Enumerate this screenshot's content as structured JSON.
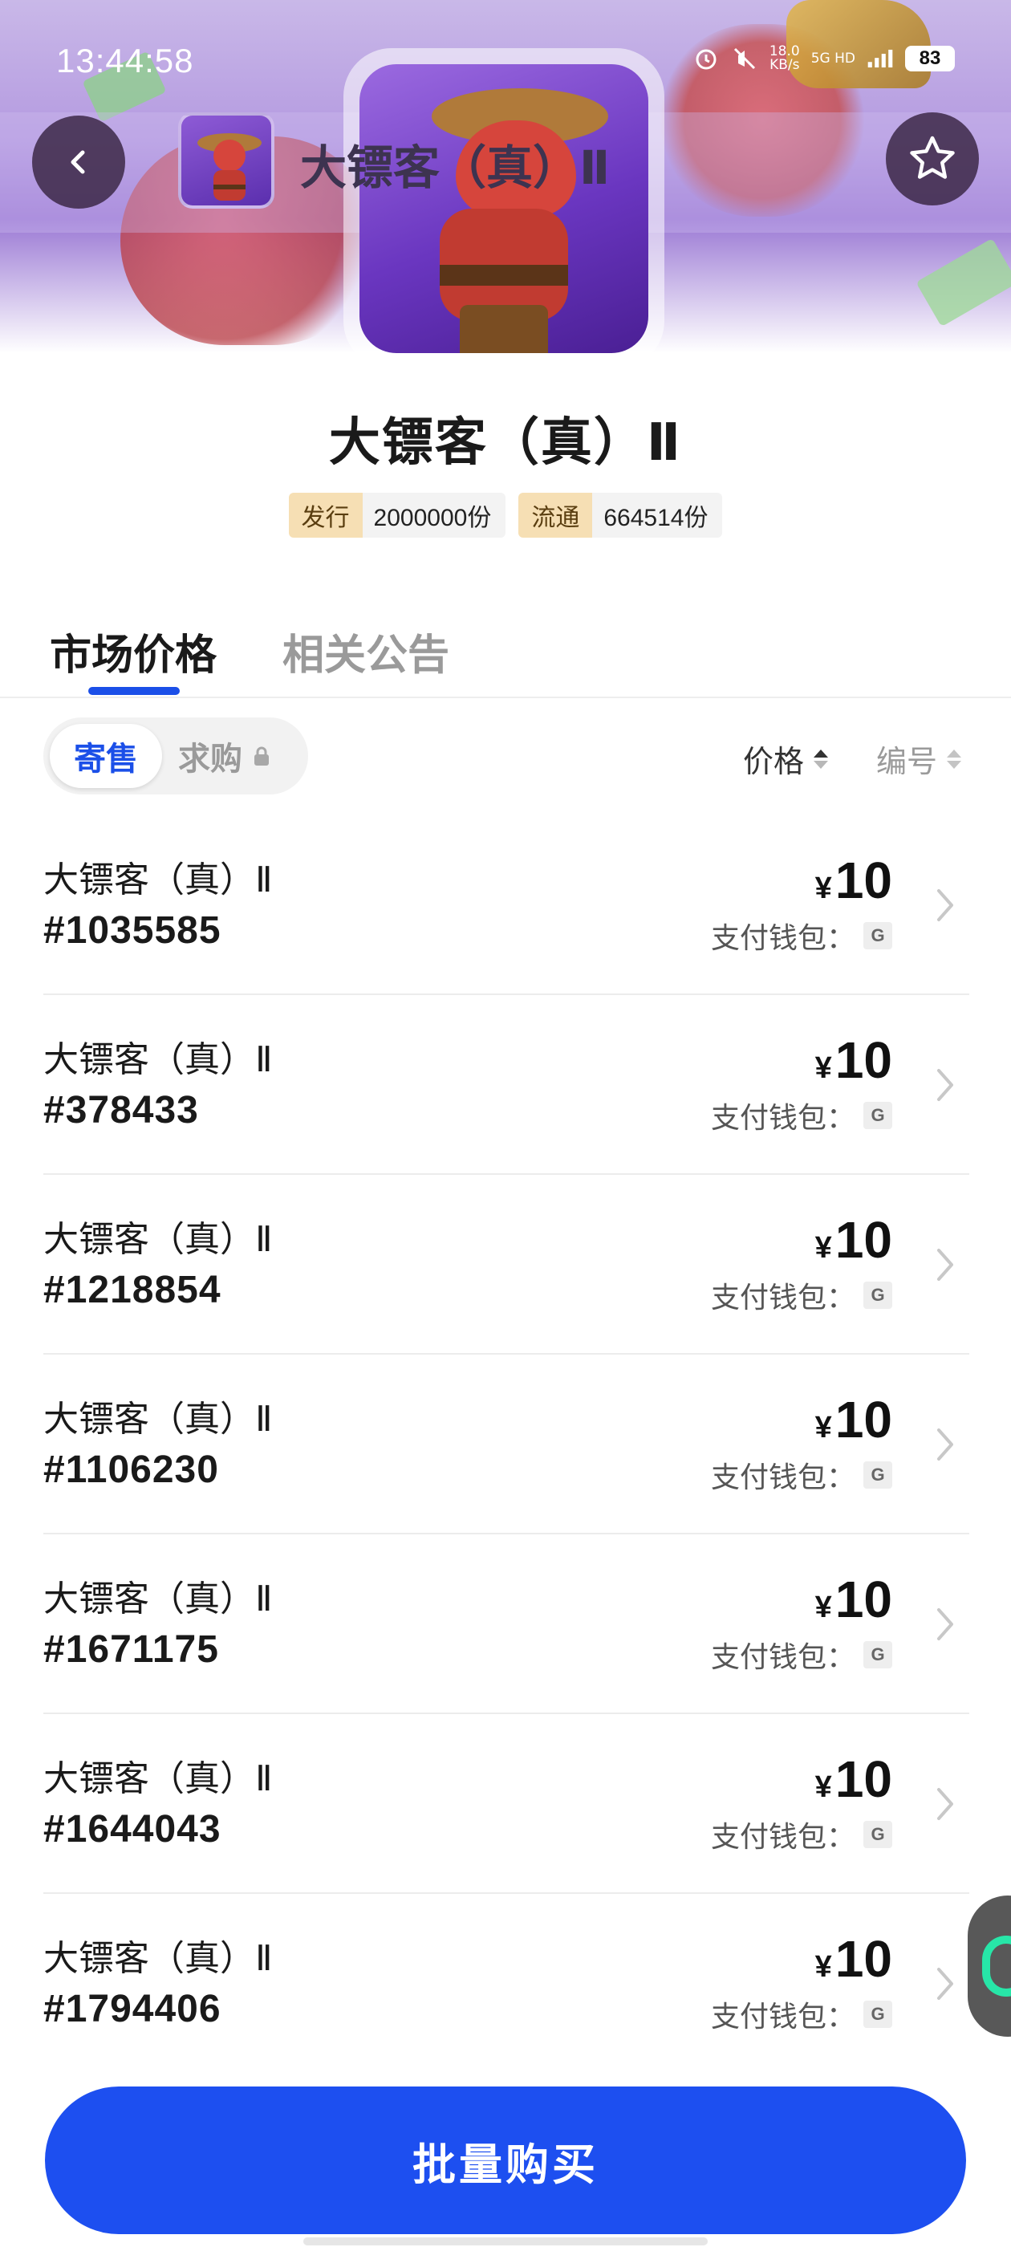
{
  "status_bar": {
    "time": "13:44:58",
    "net_speed": "18.0",
    "net_unit": "KB/s",
    "net_type": "5G HD",
    "battery": "83"
  },
  "nav": {
    "title": "大镖客（真）Ⅱ",
    "back_icon": "chevron-left-icon",
    "fav_icon": "star-outline-icon"
  },
  "collection": {
    "title": "大镖客（真）Ⅱ",
    "issued_label": "发行",
    "issued_value": "2000000份",
    "circulating_label": "流通",
    "circulating_value": "664514份"
  },
  "tabs": [
    {
      "label": "市场价格",
      "active": true
    },
    {
      "label": "相关公告",
      "active": false
    }
  ],
  "filter": {
    "segment_sell": "寄售",
    "segment_buy": "求购",
    "sort_price": "价格",
    "sort_number": "编号"
  },
  "listings": [
    {
      "name": "大镖客（真）Ⅱ",
      "id": "#1035585",
      "currency": "¥",
      "price": "10",
      "pay_label": "支付钱包：",
      "wallet": "G"
    },
    {
      "name": "大镖客（真）Ⅱ",
      "id": "#378433",
      "currency": "¥",
      "price": "10",
      "pay_label": "支付钱包：",
      "wallet": "G"
    },
    {
      "name": "大镖客（真）Ⅱ",
      "id": "#1218854",
      "currency": "¥",
      "price": "10",
      "pay_label": "支付钱包：",
      "wallet": "G"
    },
    {
      "name": "大镖客（真）Ⅱ",
      "id": "#1106230",
      "currency": "¥",
      "price": "10",
      "pay_label": "支付钱包：",
      "wallet": "G"
    },
    {
      "name": "大镖客（真）Ⅱ",
      "id": "#1671175",
      "currency": "¥",
      "price": "10",
      "pay_label": "支付钱包：",
      "wallet": "G"
    },
    {
      "name": "大镖客（真）Ⅱ",
      "id": "#1644043",
      "currency": "¥",
      "price": "10",
      "pay_label": "支付钱包：",
      "wallet": "G"
    },
    {
      "name": "大镖客（真）Ⅱ",
      "id": "#1794406",
      "currency": "¥",
      "price": "10",
      "pay_label": "支付钱包：",
      "wallet": "G"
    }
  ],
  "actions": {
    "bulk_buy": "批量购买"
  },
  "colors": {
    "accent": "#1d4ff0",
    "chip_key_bg": "#f6dfb4",
    "hero_purple": "#9a78d4"
  }
}
